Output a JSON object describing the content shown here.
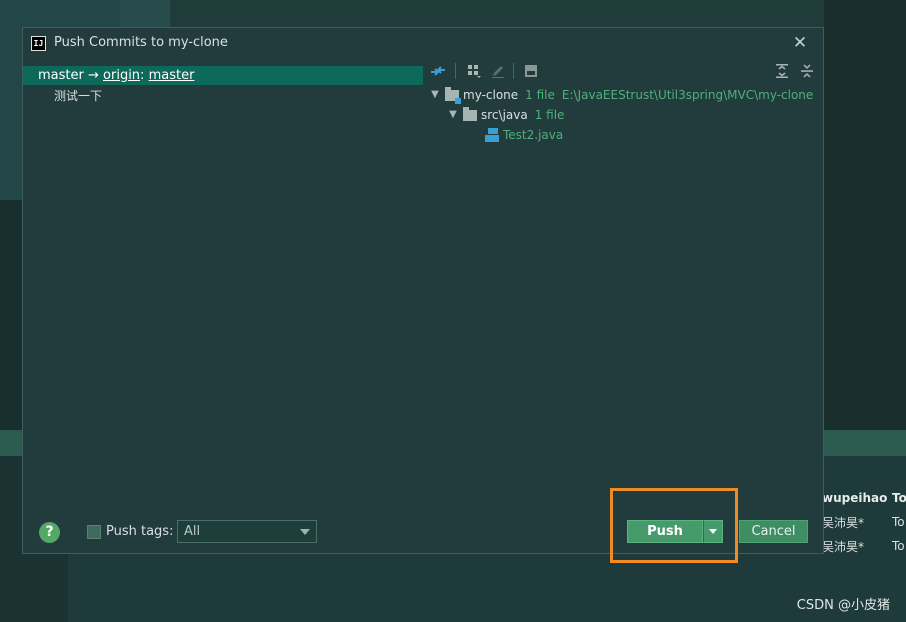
{
  "dialog": {
    "app_icon_text": "IJ",
    "title": "Push Commits to my-clone",
    "close_glyph": "✕"
  },
  "commits": {
    "branch_local": "master",
    "arrow": "→",
    "remote": "origin",
    "separator": ":",
    "branch_remote": "master",
    "commit_message": "测试一下"
  },
  "toolbar": {
    "icons": [
      "pull-push-icon",
      "group-by-icon",
      "edit-icon",
      "preview-icon",
      "expand-all-icon",
      "collapse-all-icon"
    ]
  },
  "tree": {
    "root_name": "my-clone",
    "root_count": "1 file",
    "root_path": "E:\\JavaEEStrust\\Util3spring\\MVC\\my-clone",
    "folder_name": "src\\java",
    "folder_count": "1 file",
    "file_name": "Test2.java"
  },
  "footer": {
    "help_glyph": "?",
    "push_tags_label": "Push tags:",
    "push_tags_value": "All",
    "push_label": "Push",
    "cancel_label": "Cancel"
  },
  "background": {
    "table_header_author": "wupeihao",
    "table_header_next": "To",
    "row1_author": "吴沛昊*",
    "row1_next": "To",
    "row2_author": "吴沛昊*",
    "row2_next": "To",
    "watermark": "CSDN @小皮猪"
  },
  "colors": {
    "selection": "#0d6a5b",
    "accent_green": "#479a6b",
    "vcs_green": "#4fb07c",
    "highlight_orange": "#f08a24"
  }
}
